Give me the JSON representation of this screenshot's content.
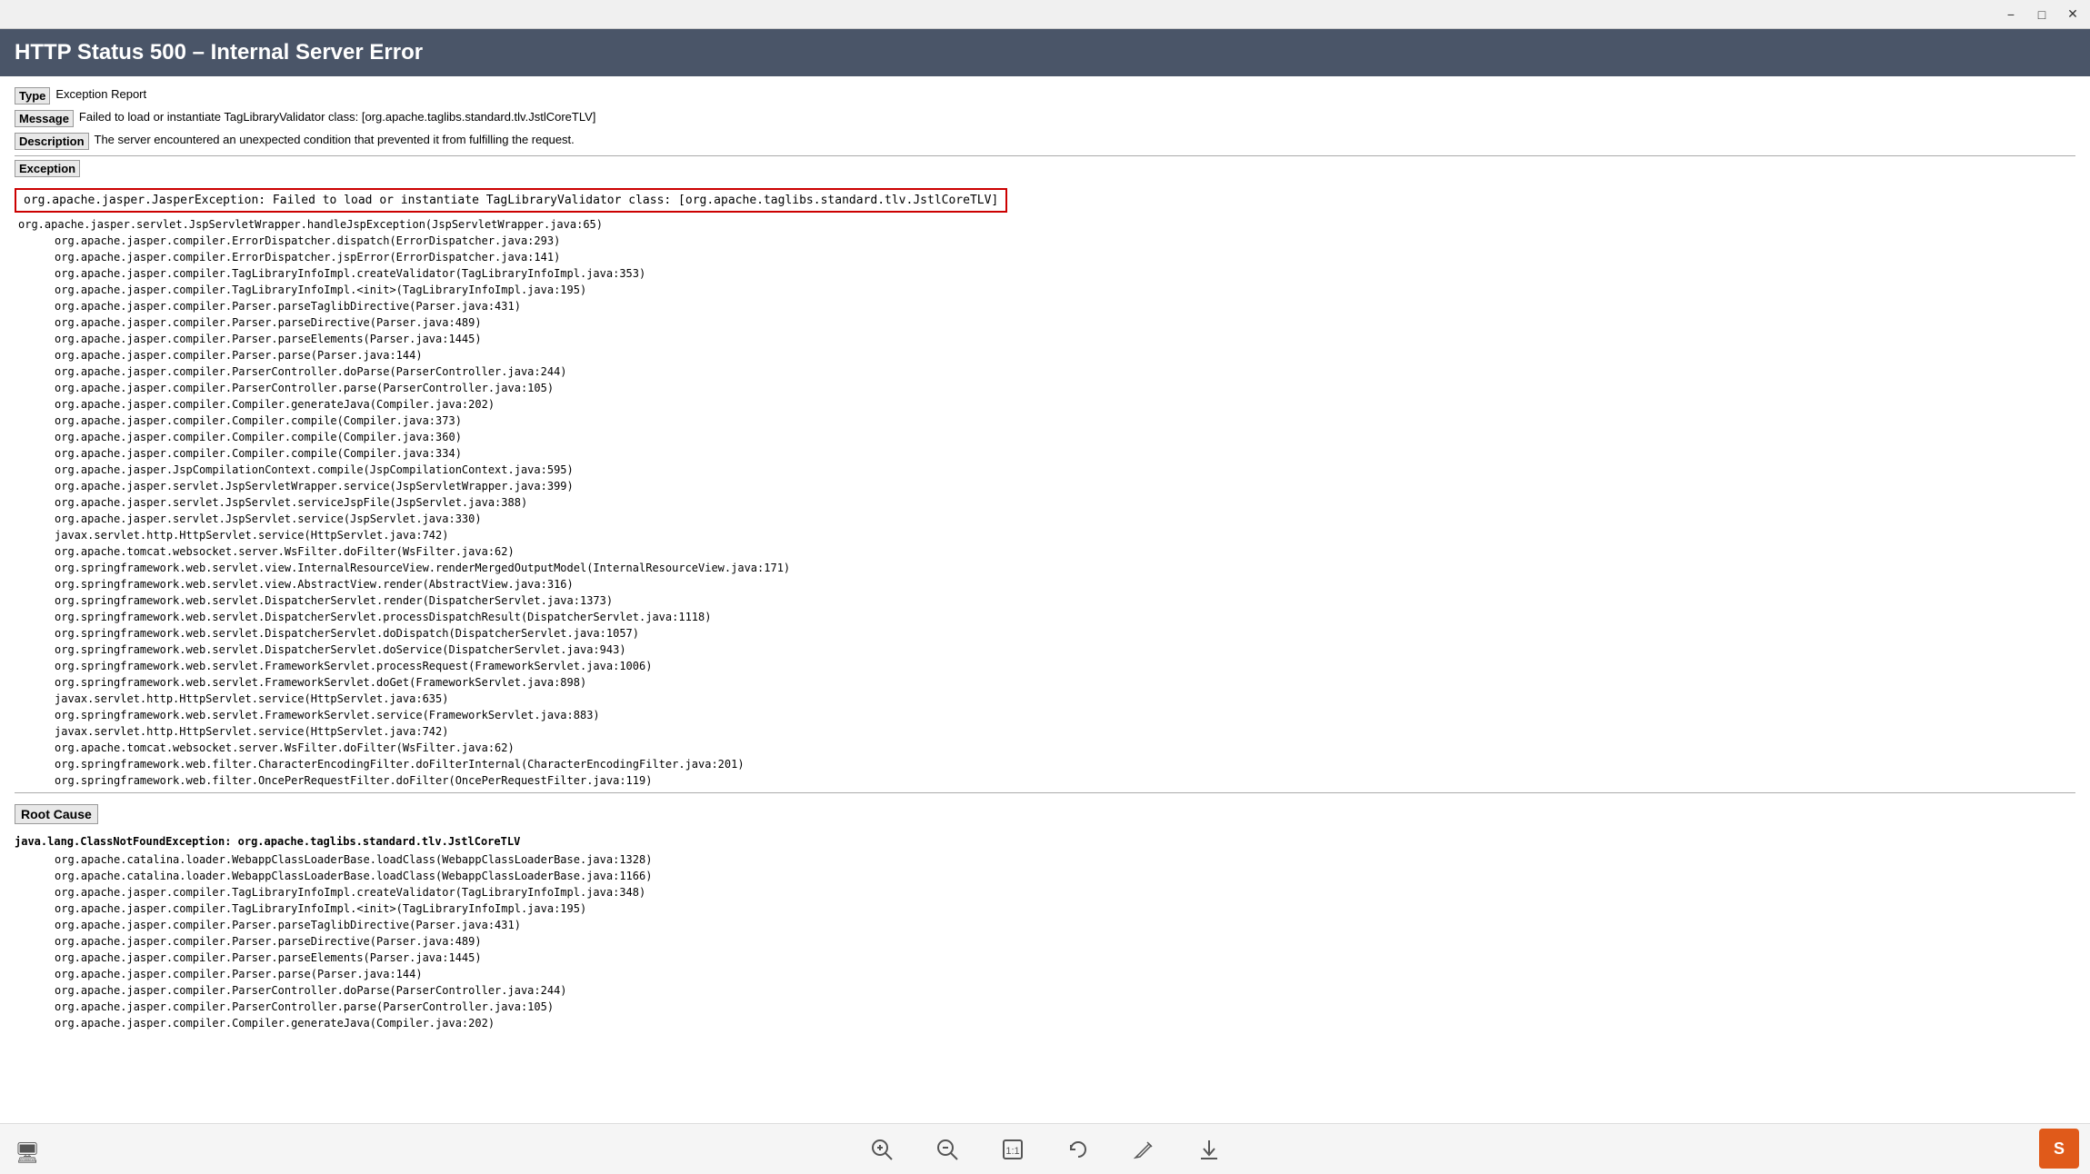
{
  "titleBar": {
    "minimizeLabel": "−",
    "maximizeLabel": "□",
    "closeLabel": "✕"
  },
  "header": {
    "title": "HTTP Status 500 – Internal Server Error"
  },
  "fields": {
    "typeLabel": "Type",
    "typeValue": "Exception Report",
    "messageLabel": "Message",
    "messageValue": "Failed to load or instantiate TagLibraryValidator class: [org.apache.taglibs.standard.tlv.JstlCoreTLV]",
    "descriptionLabel": "Description",
    "descriptionValue": "The server encountered an unexpected condition that prevented it from fulfilling the request."
  },
  "exceptionSection": {
    "headerLabel": "Exception",
    "mainException": "org.apache.jasper.JasperException: Failed to load or instantiate TagLibraryValidator class: [org.apache.taglibs.standard.tlv.JstlCoreTLV]",
    "stackTrace": [
      "org.apache.jasper.servlet.JspServletWrapper.handleJspException(JspServletWrapper.java:65)",
      "\torg.apache.jasper.compiler.ErrorDispatcher.dispatch(ErrorDispatcher.java:293)",
      "\torg.apache.jasper.compiler.ErrorDispatcher.jspError(ErrorDispatcher.java:141)",
      "\torg.apache.jasper.compiler.TagLibraryInfoImpl.createValidator(TagLibraryInfoImpl.java:353)",
      "\torg.apache.jasper.compiler.TagLibraryInfoImpl.<init>(TagLibraryInfoImpl.java:195)",
      "\torg.apache.jasper.compiler.Parser.parseTaglibDirective(Parser.java:431)",
      "\torg.apache.jasper.compiler.Parser.parseDirective(Parser.java:489)",
      "\torg.apache.jasper.compiler.Parser.parseElements(Parser.java:1445)",
      "\torg.apache.jasper.compiler.Parser.parse(Parser.java:144)",
      "\torg.apache.jasper.compiler.ParserController.doParse(ParserController.java:244)",
      "\torg.apache.jasper.compiler.ParserController.parse(ParserController.java:105)",
      "\torg.apache.jasper.compiler.Compiler.generateJava(Compiler.java:202)",
      "\torg.apache.jasper.compiler.Compiler.compile(Compiler.java:373)",
      "\torg.apache.jasper.compiler.Compiler.compile(Compiler.java:360)",
      "\torg.apache.jasper.compiler.Compiler.compile(Compiler.java:334)",
      "\torg.apache.jasper.JspCompilationContext.compile(JspCompilationContext.java:595)",
      "\torg.apache.jasper.servlet.JspServletWrapper.service(JspServletWrapper.java:399)",
      "\torg.apache.jasper.servlet.JspServlet.serviceJspFile(JspServlet.java:388)",
      "\torg.apache.jasper.servlet.JspServlet.service(JspServlet.java:330)",
      "\tjavax.servlet.http.HttpServlet.service(HttpServlet.java:742)",
      "\torg.apache.tomcat.websocket.server.WsFilter.doFilter(WsFilter.java:62)",
      "\torg.springframework.web.servlet.view.InternalResourceView.renderMergedOutputModel(InternalResourceView.java:171)",
      "\torg.springframework.web.servlet.view.AbstractView.render(AbstractView.java:316)",
      "\torg.springframework.web.servlet.DispatcherServlet.render(DispatcherServlet.java:1373)",
      "\torg.springframework.web.servlet.DispatcherServlet.processDispatchResult(DispatcherServlet.java:1118)",
      "\torg.springframework.web.servlet.DispatcherServlet.doDispatch(DispatcherServlet.java:1057)",
      "\torg.springframework.web.servlet.DispatcherServlet.doService(DispatcherServlet.java:943)",
      "\torg.springframework.web.servlet.FrameworkServlet.processRequest(FrameworkServlet.java:1006)",
      "\torg.springframework.web.servlet.FrameworkServlet.doGet(FrameworkServlet.java:898)",
      "\tjavax.servlet.http.HttpServlet.service(HttpServlet.java:635)",
      "\torg.springframework.web.servlet.FrameworkServlet.service(FrameworkServlet.java:883)",
      "\tjavax.servlet.http.HttpServlet.service(HttpServlet.java:742)",
      "\torg.apache.tomcat.websocket.server.WsFilter.doFilter(WsFilter.java:62)",
      "\torg.springframework.web.filter.CharacterEncodingFilter.doFilterInternal(CharacterEncodingFilter.java:201)",
      "\torg.springframework.web.filter.OncePerRequestFilter.doFilter(OncePerRequestFilter.java:119)"
    ]
  },
  "rootCauseSection": {
    "headerLabel": "Root Cause",
    "mainException": "java.lang.ClassNotFoundException: org.apache.taglibs.standard.tlv.JstlCoreTLV",
    "stackTrace": [
      "\torg.apache.catalina.loader.WebappClassLoaderBase.loadClass(WebappClassLoaderBase.java:1328)",
      "\torg.apache.catalina.loader.WebappClassLoaderBase.loadClass(WebappClassLoaderBase.java:1166)",
      "\torg.apache.jasper.compiler.TagLibraryInfoImpl.createValidator(TagLibraryInfoImpl.java:348)",
      "\torg.apache.jasper.compiler.TagLibraryInfoImpl.<init>(TagLibraryInfoImpl.java:195)",
      "\torg.apache.jasper.compiler.Parser.parseTaglibDirective(Parser.java:431)",
      "\torg.apache.jasper.compiler.Parser.parseDirective(Parser.java:489)",
      "\torg.apache.jasper.compiler.Parser.parseElements(Parser.java:1445)",
      "\torg.apache.jasper.compiler.Parser.parse(Parser.java:144)",
      "\torg.apache.jasper.compiler.ParserController.doParse(ParserController.java:244)",
      "\torg.apache.jasper.compiler.ParserController.parse(ParserController.java:105)",
      "\torg.apache.jasper.compiler.Compiler.generateJava(Compiler.java:202)"
    ]
  },
  "toolbar": {
    "zoomInLabel": "⊕",
    "zoomOutLabel": "⊖",
    "fitLabel": "1:1",
    "rotateLabel": "↻",
    "editLabel": "✎",
    "downloadLabel": "⬇",
    "monitorIcon": "🖥",
    "logoText": "S"
  }
}
